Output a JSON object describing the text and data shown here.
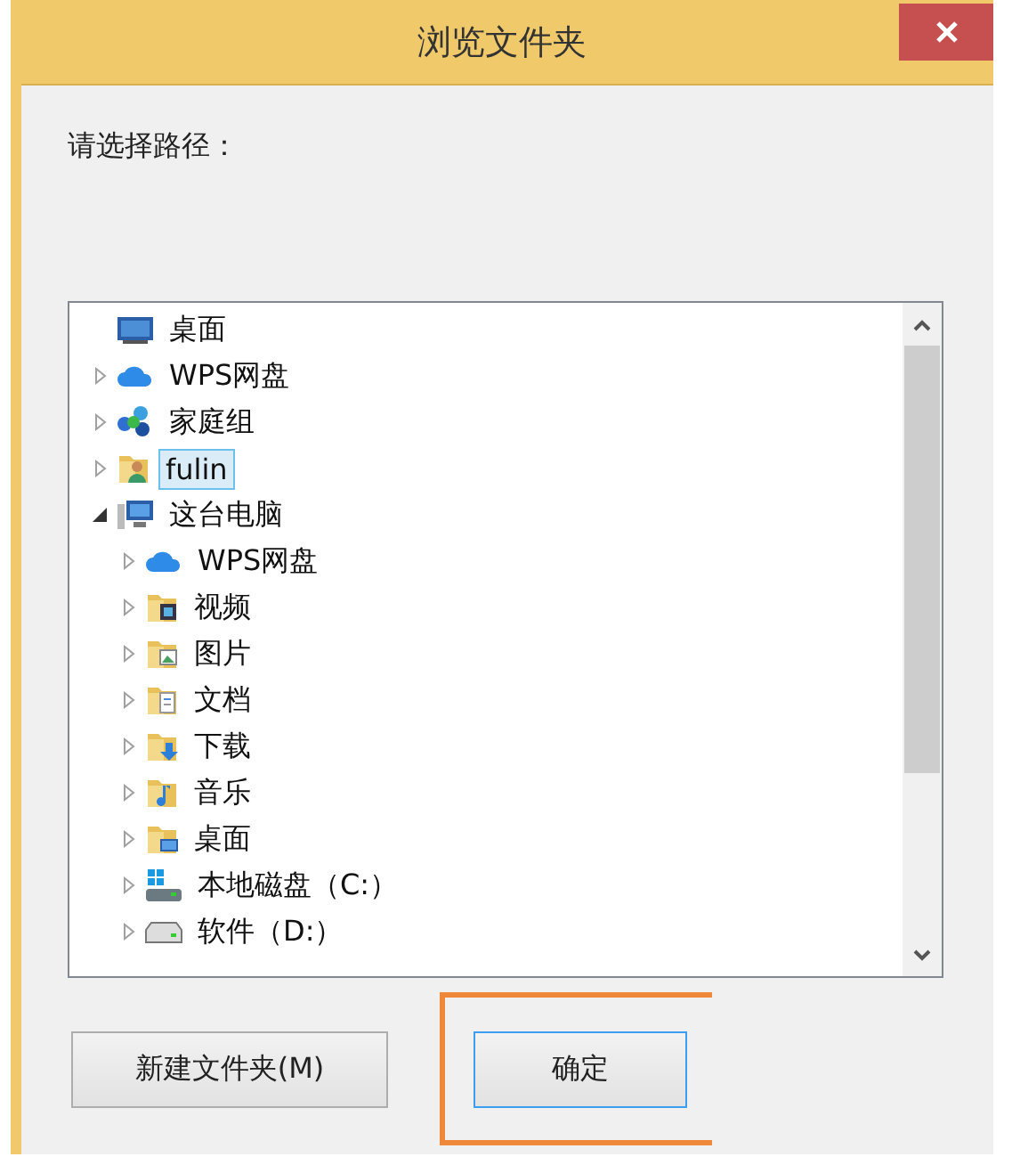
{
  "window": {
    "title": "浏览文件夹"
  },
  "prompt": "请选择路径：",
  "tree": [
    {
      "label": "桌面",
      "kind": "desktop",
      "expandable": false,
      "selected": false
    },
    {
      "label": "WPS网盘",
      "kind": "cloud",
      "expandable": true,
      "expanded": false,
      "selected": false
    },
    {
      "label": "家庭组",
      "kind": "homegroup",
      "expandable": true,
      "expanded": false,
      "selected": false
    },
    {
      "label": "fulin",
      "kind": "user",
      "expandable": true,
      "expanded": false,
      "selected": true
    },
    {
      "label": "这台电脑",
      "kind": "computer",
      "expandable": true,
      "expanded": true,
      "selected": false,
      "children": [
        {
          "label": "WPS网盘",
          "kind": "cloud",
          "expandable": true,
          "expanded": false,
          "selected": false
        },
        {
          "label": "视频",
          "kind": "video-folder",
          "expandable": true,
          "expanded": false,
          "selected": false
        },
        {
          "label": "图片",
          "kind": "picture-folder",
          "expandable": true,
          "expanded": false,
          "selected": false
        },
        {
          "label": "文档",
          "kind": "document-folder",
          "expandable": true,
          "expanded": false,
          "selected": false
        },
        {
          "label": "下载",
          "kind": "download-folder",
          "expandable": true,
          "expanded": false,
          "selected": false
        },
        {
          "label": "音乐",
          "kind": "music-folder",
          "expandable": true,
          "expanded": false,
          "selected": false
        },
        {
          "label": "桌面",
          "kind": "desktop-folder",
          "expandable": true,
          "expanded": false,
          "selected": false
        },
        {
          "label": "本地磁盘（C:）",
          "kind": "system-drive",
          "expandable": true,
          "expanded": false,
          "selected": false
        },
        {
          "label": "软件（D:）",
          "kind": "drive",
          "expandable": true,
          "expanded": false,
          "selected": false
        }
      ]
    }
  ],
  "buttons": [
    {
      "label": "新建文件夹(M)",
      "focused": false
    },
    {
      "label": "确定",
      "focused": true
    }
  ]
}
